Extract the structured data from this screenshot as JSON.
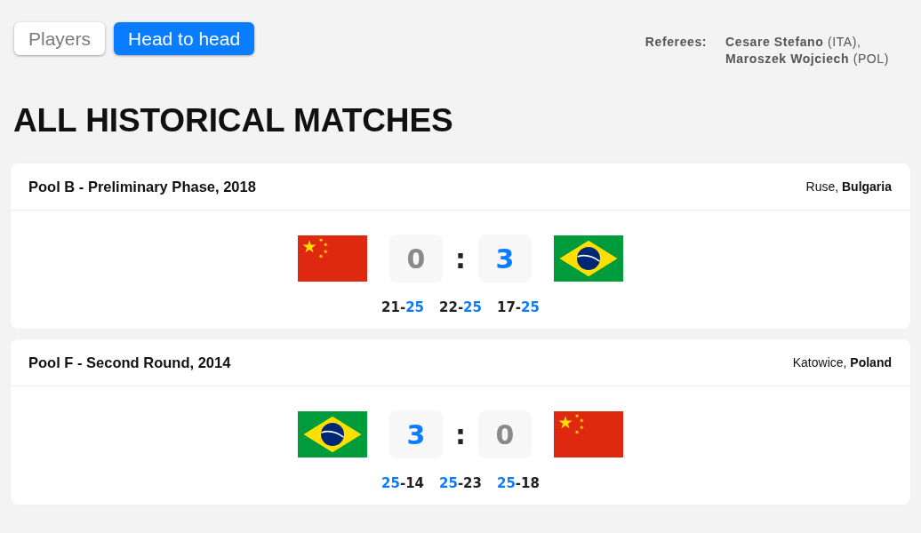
{
  "tabs": [
    {
      "label": "Players",
      "selected": false
    },
    {
      "label": "Head to head",
      "selected": true
    }
  ],
  "referees": {
    "label": "Referees:",
    "names": [
      "**Cesare Stefano** (ITA),",
      "**Maroszek Wojciech** (POL)"
    ]
  },
  "heading": "ALL HISTORICAL MATCHES",
  "matches": [
    {
      "title": "Pool B - Preliminary Phase, 2018",
      "location": "Ruse, **Bulgaria**",
      "home": {
        "kind": "china",
        "score": "0",
        "winner": false
      },
      "separator": ":",
      "away": {
        "kind": "brazil",
        "score": "3",
        "winner": true
      },
      "sets": [
        {
          "home": {
            "points": "21",
            "winner": false
          },
          "dash": "-",
          "away": {
            "points": "25",
            "winner": true
          }
        },
        {
          "home": {
            "points": "22",
            "winner": false
          },
          "dash": "-",
          "away": {
            "points": "25",
            "winner": true
          }
        },
        {
          "home": {
            "points": "17",
            "winner": false
          },
          "dash": "-",
          "away": {
            "points": "25",
            "winner": true
          }
        }
      ]
    },
    {
      "title": "Pool F - Second Round, 2014",
      "location": "Katowice, **Poland**",
      "home": {
        "kind": "brazil",
        "score": "3",
        "winner": true
      },
      "separator": ":",
      "away": {
        "kind": "china",
        "score": "0",
        "winner": false
      },
      "sets": [
        {
          "home": {
            "points": "25",
            "winner": true
          },
          "dash": "-",
          "away": {
            "points": "14",
            "winner": false
          }
        },
        {
          "home": {
            "points": "25",
            "winner": true
          },
          "dash": "-",
          "away": {
            "points": "23",
            "winner": false
          }
        },
        {
          "home": {
            "points": "25",
            "winner": true
          },
          "dash": "-",
          "away": {
            "points": "18",
            "winner": false
          }
        }
      ]
    }
  ]
}
